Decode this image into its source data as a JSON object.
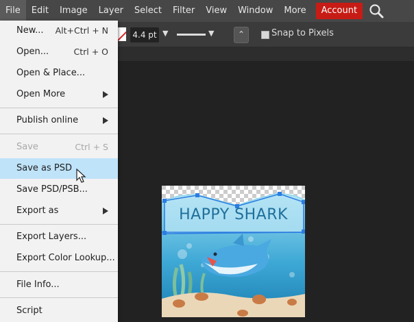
{
  "menubar": {
    "items": [
      "File",
      "Edit",
      "Image",
      "Layer",
      "Select",
      "Filter",
      "View",
      "Window",
      "More"
    ],
    "account_label": "Account",
    "search_icon": "search-icon"
  },
  "options": {
    "stroke_size": "4.4 pt",
    "snap_label": "Snap to Pixels",
    "snap_checked": false
  },
  "file_menu": {
    "items": [
      {
        "label": "New...",
        "shortcut": "Alt+Ctrl + N"
      },
      {
        "label": "Open...",
        "shortcut": "Ctrl + O"
      },
      {
        "label": "Open & Place...",
        "shortcut": ""
      },
      {
        "label": "Open More",
        "shortcut": "",
        "submenu": true
      },
      {
        "label": "Publish online",
        "shortcut": "",
        "submenu": true
      },
      {
        "label": "Save",
        "shortcut": "Ctrl + S",
        "disabled": true
      },
      {
        "label": "Save as PSD",
        "shortcut": "",
        "hovered": true
      },
      {
        "label": "Save PSD/PSB...",
        "shortcut": ""
      },
      {
        "label": "Export as",
        "shortcut": "",
        "submenu": true
      },
      {
        "label": "Export Layers...",
        "shortcut": ""
      },
      {
        "label": "Export Color Lookup...",
        "shortcut": ""
      },
      {
        "label": "File Info...",
        "shortcut": ""
      },
      {
        "label": "Script",
        "shortcut": ""
      }
    ]
  },
  "document": {
    "title_text": "HAPPY SHARK"
  },
  "colors": {
    "accent": "#c71c15",
    "menu_hover": "#bfe3f9",
    "selection": "#2a7de1"
  }
}
